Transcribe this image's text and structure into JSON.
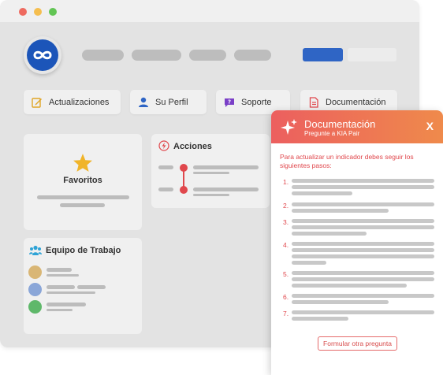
{
  "nav": {
    "actualizaciones": "Actualizaciones",
    "perfil": "Su Perfil",
    "soporte": "Soporte",
    "documentacion": "Documentación"
  },
  "cards": {
    "favoritos": "Favoritos",
    "acciones": "Acciones",
    "equipo": "Equipo de Trabajo"
  },
  "team_avatar_colors": [
    "#d9b675",
    "#8aa6d8",
    "#5fb86a"
  ],
  "popup": {
    "title": "Documentación",
    "subtitle": "Pregunte a KIA Pair",
    "close": "X",
    "intro": "Para actualizar un indicador debes seguir los siguientes pasos:",
    "steps": [
      "1.",
      "2.",
      "3.",
      "4.",
      "5.",
      "6.",
      "7."
    ],
    "button": "Formular otra pregunta"
  },
  "colors": {
    "brand_blue": "#1c55b9",
    "accent_red": "#e0474c",
    "gradient_start": "#ec5f5f",
    "gradient_end": "#ef8a4b"
  }
}
